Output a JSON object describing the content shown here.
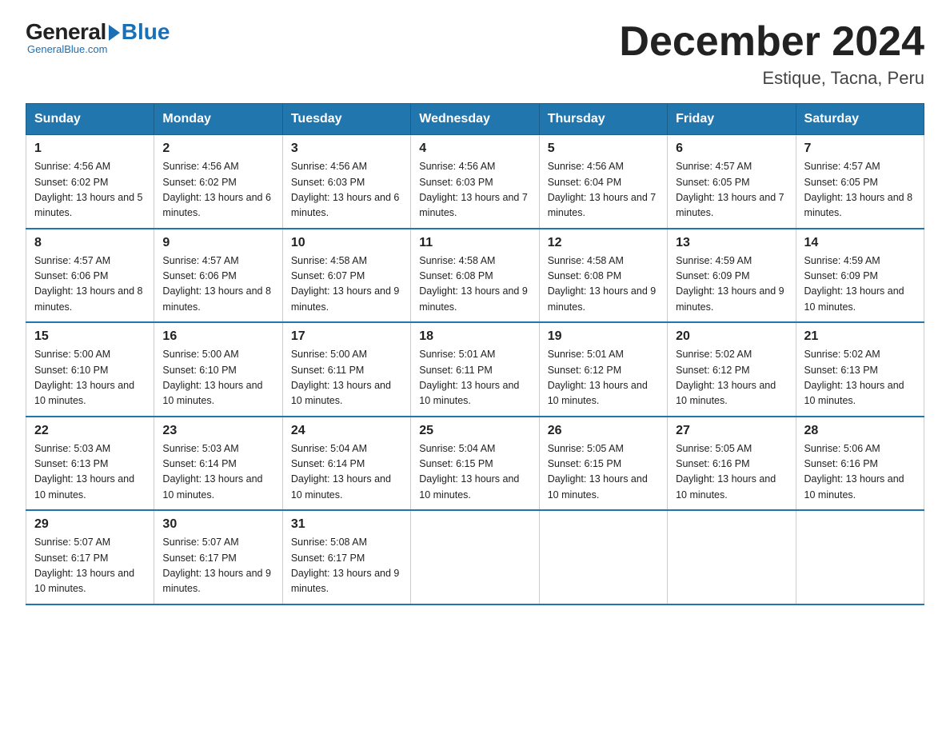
{
  "logo": {
    "general": "General",
    "blue": "Blue",
    "tagline": "GeneralBlue.com"
  },
  "title": "December 2024",
  "location": "Estique, Tacna, Peru",
  "weekdays": [
    "Sunday",
    "Monday",
    "Tuesday",
    "Wednesday",
    "Thursday",
    "Friday",
    "Saturday"
  ],
  "weeks": [
    [
      {
        "num": "1",
        "sunrise": "4:56 AM",
        "sunset": "6:02 PM",
        "daylight": "13 hours and 5 minutes."
      },
      {
        "num": "2",
        "sunrise": "4:56 AM",
        "sunset": "6:02 PM",
        "daylight": "13 hours and 6 minutes."
      },
      {
        "num": "3",
        "sunrise": "4:56 AM",
        "sunset": "6:03 PM",
        "daylight": "13 hours and 6 minutes."
      },
      {
        "num": "4",
        "sunrise": "4:56 AM",
        "sunset": "6:03 PM",
        "daylight": "13 hours and 7 minutes."
      },
      {
        "num": "5",
        "sunrise": "4:56 AM",
        "sunset": "6:04 PM",
        "daylight": "13 hours and 7 minutes."
      },
      {
        "num": "6",
        "sunrise": "4:57 AM",
        "sunset": "6:05 PM",
        "daylight": "13 hours and 7 minutes."
      },
      {
        "num": "7",
        "sunrise": "4:57 AM",
        "sunset": "6:05 PM",
        "daylight": "13 hours and 8 minutes."
      }
    ],
    [
      {
        "num": "8",
        "sunrise": "4:57 AM",
        "sunset": "6:06 PM",
        "daylight": "13 hours and 8 minutes."
      },
      {
        "num": "9",
        "sunrise": "4:57 AM",
        "sunset": "6:06 PM",
        "daylight": "13 hours and 8 minutes."
      },
      {
        "num": "10",
        "sunrise": "4:58 AM",
        "sunset": "6:07 PM",
        "daylight": "13 hours and 9 minutes."
      },
      {
        "num": "11",
        "sunrise": "4:58 AM",
        "sunset": "6:08 PM",
        "daylight": "13 hours and 9 minutes."
      },
      {
        "num": "12",
        "sunrise": "4:58 AM",
        "sunset": "6:08 PM",
        "daylight": "13 hours and 9 minutes."
      },
      {
        "num": "13",
        "sunrise": "4:59 AM",
        "sunset": "6:09 PM",
        "daylight": "13 hours and 9 minutes."
      },
      {
        "num": "14",
        "sunrise": "4:59 AM",
        "sunset": "6:09 PM",
        "daylight": "13 hours and 10 minutes."
      }
    ],
    [
      {
        "num": "15",
        "sunrise": "5:00 AM",
        "sunset": "6:10 PM",
        "daylight": "13 hours and 10 minutes."
      },
      {
        "num": "16",
        "sunrise": "5:00 AM",
        "sunset": "6:10 PM",
        "daylight": "13 hours and 10 minutes."
      },
      {
        "num": "17",
        "sunrise": "5:00 AM",
        "sunset": "6:11 PM",
        "daylight": "13 hours and 10 minutes."
      },
      {
        "num": "18",
        "sunrise": "5:01 AM",
        "sunset": "6:11 PM",
        "daylight": "13 hours and 10 minutes."
      },
      {
        "num": "19",
        "sunrise": "5:01 AM",
        "sunset": "6:12 PM",
        "daylight": "13 hours and 10 minutes."
      },
      {
        "num": "20",
        "sunrise": "5:02 AM",
        "sunset": "6:12 PM",
        "daylight": "13 hours and 10 minutes."
      },
      {
        "num": "21",
        "sunrise": "5:02 AM",
        "sunset": "6:13 PM",
        "daylight": "13 hours and 10 minutes."
      }
    ],
    [
      {
        "num": "22",
        "sunrise": "5:03 AM",
        "sunset": "6:13 PM",
        "daylight": "13 hours and 10 minutes."
      },
      {
        "num": "23",
        "sunrise": "5:03 AM",
        "sunset": "6:14 PM",
        "daylight": "13 hours and 10 minutes."
      },
      {
        "num": "24",
        "sunrise": "5:04 AM",
        "sunset": "6:14 PM",
        "daylight": "13 hours and 10 minutes."
      },
      {
        "num": "25",
        "sunrise": "5:04 AM",
        "sunset": "6:15 PM",
        "daylight": "13 hours and 10 minutes."
      },
      {
        "num": "26",
        "sunrise": "5:05 AM",
        "sunset": "6:15 PM",
        "daylight": "13 hours and 10 minutes."
      },
      {
        "num": "27",
        "sunrise": "5:05 AM",
        "sunset": "6:16 PM",
        "daylight": "13 hours and 10 minutes."
      },
      {
        "num": "28",
        "sunrise": "5:06 AM",
        "sunset": "6:16 PM",
        "daylight": "13 hours and 10 minutes."
      }
    ],
    [
      {
        "num": "29",
        "sunrise": "5:07 AM",
        "sunset": "6:17 PM",
        "daylight": "13 hours and 10 minutes."
      },
      {
        "num": "30",
        "sunrise": "5:07 AM",
        "sunset": "6:17 PM",
        "daylight": "13 hours and 9 minutes."
      },
      {
        "num": "31",
        "sunrise": "5:08 AM",
        "sunset": "6:17 PM",
        "daylight": "13 hours and 9 minutes."
      },
      null,
      null,
      null,
      null
    ]
  ]
}
